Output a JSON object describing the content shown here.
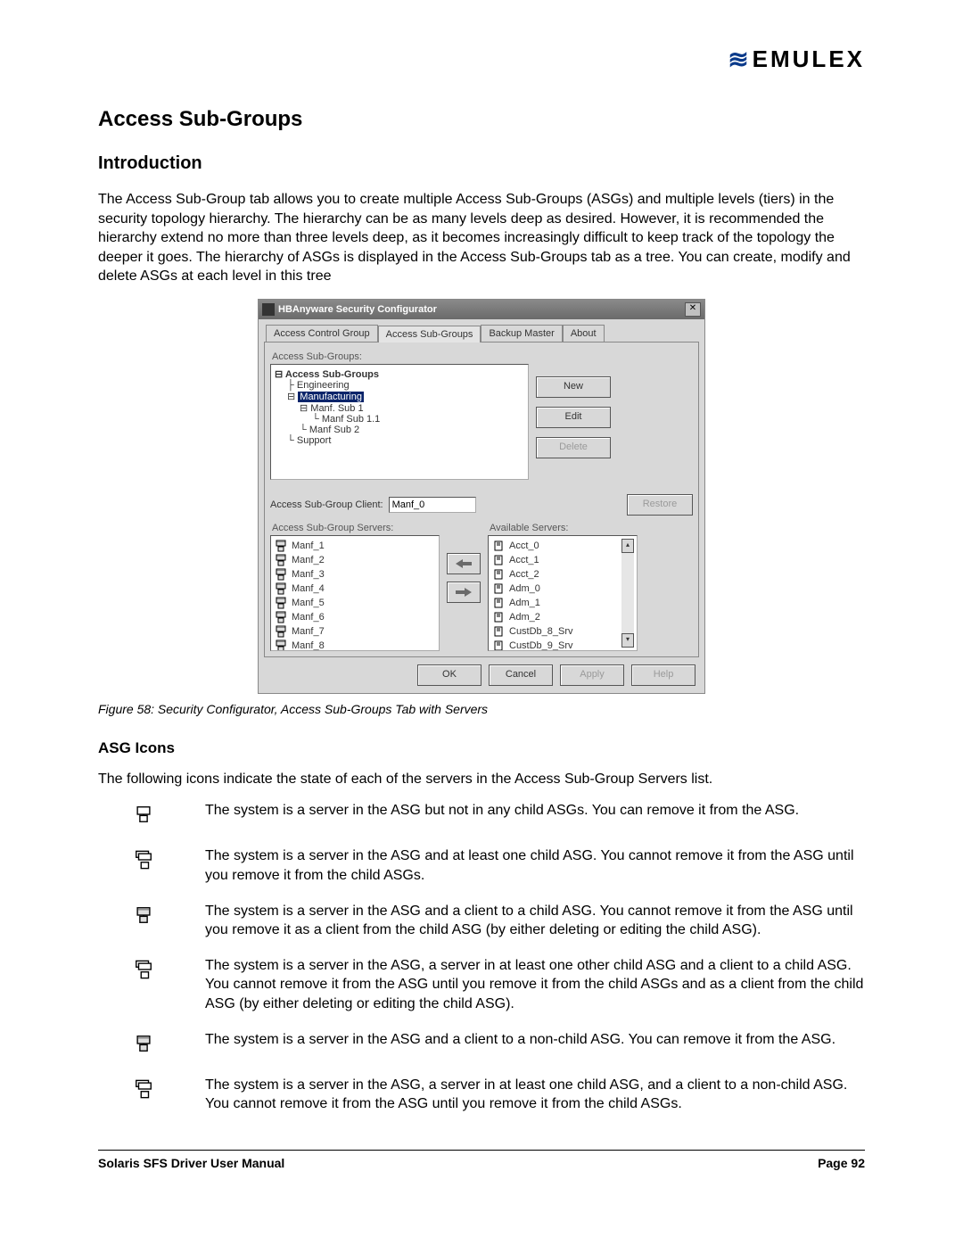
{
  "logo": {
    "mark": "≋",
    "text": "EMULEX"
  },
  "h1": "Access Sub-Groups",
  "h2": "Introduction",
  "intro": "The Access Sub-Group tab allows you to create multiple Access Sub-Groups (ASGs) and multiple levels (tiers) in the security topology hierarchy. The hierarchy can be as many levels deep as desired. However, it is recommended the hierarchy extend no more than three levels deep, as it becomes increasingly difficult to keep track of the topology the deeper it goes. The hierarchy of ASGs is displayed in the Access Sub-Groups tab as a tree. You can create, modify and delete ASGs at each level in this tree",
  "caption": "Figure 58: Security Configurator, Access Sub-Groups Tab with Servers",
  "asg_icons_heading": "ASG Icons",
  "asg_icons_intro": "The following icons indicate the state of each of the servers in the Access Sub-Group Servers list.",
  "icon_descs": {
    "d0": "The system is a server in the ASG but not in any child ASGs. You can remove it from the ASG.",
    "d1": "The system is a server in the ASG and at least one child ASG. You cannot remove it from the ASG until you remove it from the child ASGs.",
    "d2": "The system is a server in the ASG and a client to a child ASG. You cannot remove it from the ASG until you remove it as a client from the child ASG (by either deleting or editing the child ASG).",
    "d3": "The system is a server in the ASG, a server in at least one other child ASG and a client to a child ASG. You cannot remove it from the ASG until you remove it from the child ASGs and as a client from the child ASG (by either deleting or editing the child ASG).",
    "d4": "The system is a server in the ASG and a client to a non-child ASG. You can remove it from the ASG.",
    "d5": "The system is a server in the ASG, a server in at least one child ASG, and a client to a non-child ASG. You cannot remove it from the ASG until you remove it from the child ASGs."
  },
  "dialog": {
    "title": "HBAnyware Security Configurator",
    "tabs": {
      "t0": "Access Control Group",
      "t1": "Access Sub-Groups",
      "t2": "Backup Master",
      "t3": "About"
    },
    "labels": {
      "tree_section": "Access Sub-Groups:",
      "client_label": "Access Sub-Group Client:",
      "asg_servers": "Access Sub-Group Servers:",
      "avail_servers": "Available Servers:"
    },
    "tree": {
      "root": "Access Sub-Groups",
      "n0": "Engineering",
      "n1": "Manufacturing",
      "n2": "Manf. Sub 1",
      "n3": "Manf Sub 1.1",
      "n4": "Manf Sub 2",
      "n5": "Support"
    },
    "buttons": {
      "new": "New",
      "edit": "Edit",
      "delete": "Delete",
      "restore": "Restore",
      "ok": "OK",
      "cancel": "Cancel",
      "apply": "Apply",
      "help": "Help"
    },
    "client_value": "Manf_0",
    "asg_servers": {
      "s0": "Manf_1",
      "s1": "Manf_2",
      "s2": "Manf_3",
      "s3": "Manf_4",
      "s4": "Manf_5",
      "s5": "Manf_6",
      "s6": "Manf_7",
      "s7": "Manf_8"
    },
    "avail_servers": {
      "a0": "Acct_0",
      "a1": "Acct_1",
      "a2": "Acct_2",
      "a3": "Adm_0",
      "a4": "Adm_1",
      "a5": "Adm_2",
      "a6": "CustDb_8_Srv",
      "a7": "CustDb_9_Srv"
    }
  },
  "footer": {
    "left": "Solaris SFS Driver User Manual",
    "right": "Page 92"
  }
}
